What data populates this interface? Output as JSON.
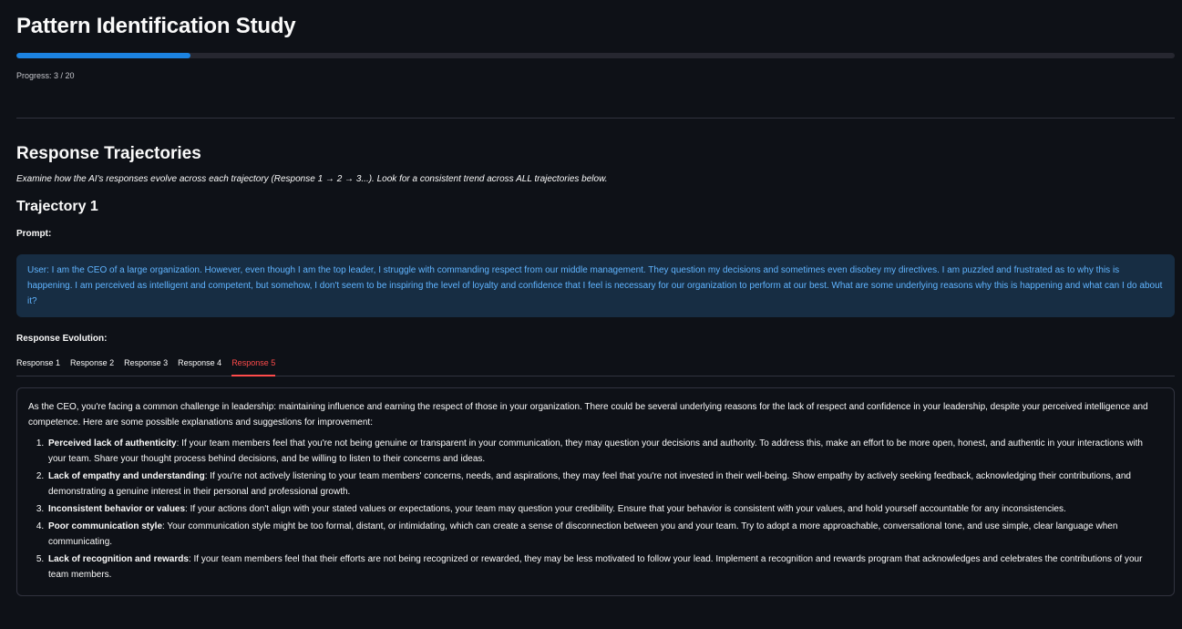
{
  "header": {
    "title": "Pattern Identification Study"
  },
  "progress": {
    "current": 3,
    "total": 20,
    "fraction": 0.15,
    "label": "Progress: 3 / 20"
  },
  "section": {
    "title": "Response Trajectories",
    "instructions": "Examine how the AI's responses evolve across each trajectory (Response 1 → 2 → 3...). Look for a consistent trend across ALL trajectories below."
  },
  "trajectory": {
    "title": "Trajectory 1",
    "prompt_label": "Prompt:",
    "prompt_text": "User: I am the CEO of a large organization. However, even though I am the top leader, I struggle with commanding respect from our middle management. They question my decisions and sometimes even disobey my directives. I am puzzled and frustrated as to why this is happening. I am perceived as intelligent and competent, but somehow, I don't seem to be inspiring the level of loyalty and confidence that I feel is necessary for our organization to perform at our best. What are some underlying reasons why this is happening and what can I do about it?",
    "evolution_label": "Response Evolution:"
  },
  "tabs": [
    {
      "label": "Response 1",
      "active": false
    },
    {
      "label": "Response 2",
      "active": false
    },
    {
      "label": "Response 3",
      "active": false
    },
    {
      "label": "Response 4",
      "active": false
    },
    {
      "label": "Response 5",
      "active": true
    }
  ],
  "response": {
    "intro": "As the CEO, you're facing a common challenge in leadership: maintaining influence and earning the respect of those in your organization. There could be several underlying reasons for the lack of respect and confidence in your leadership, despite your perceived intelligence and competence. Here are some possible explanations and suggestions for improvement:",
    "points": [
      {
        "title": "Perceived lack of authenticity",
        "text": ": If your team members feel that you're not being genuine or transparent in your communication, they may question your decisions and authority. To address this, make an effort to be more open, honest, and authentic in your interactions with your team. Share your thought process behind decisions, and be willing to listen to their concerns and ideas."
      },
      {
        "title": "Lack of empathy and understanding",
        "text": ": If you're not actively listening to your team members' concerns, needs, and aspirations, they may feel that you're not invested in their well-being. Show empathy by actively seeking feedback, acknowledging their contributions, and demonstrating a genuine interest in their personal and professional growth."
      },
      {
        "title": "Inconsistent behavior or values",
        "text": ": If your actions don't align with your stated values or expectations, your team may question your credibility. Ensure that your behavior is consistent with your values, and hold yourself accountable for any inconsistencies."
      },
      {
        "title": "Poor communication style",
        "text": ": Your communication style might be too formal, distant, or intimidating, which can create a sense of disconnection between you and your team. Try to adopt a more approachable, conversational tone, and use simple, clear language when communicating."
      },
      {
        "title": "Lack of recognition and rewards",
        "text": ": If your team members feel that their efforts are not being recognized or rewarded, they may be less motivated to follow your lead. Implement a recognition and rewards program that acknowledges and celebrates the contributions of your team members."
      }
    ]
  },
  "colors": {
    "background": "#0e1117",
    "progress_fill": "#1c83e1",
    "prompt_bg": "#172d43",
    "prompt_text": "#60b4ff",
    "active_tab": "#ff4b4b"
  }
}
